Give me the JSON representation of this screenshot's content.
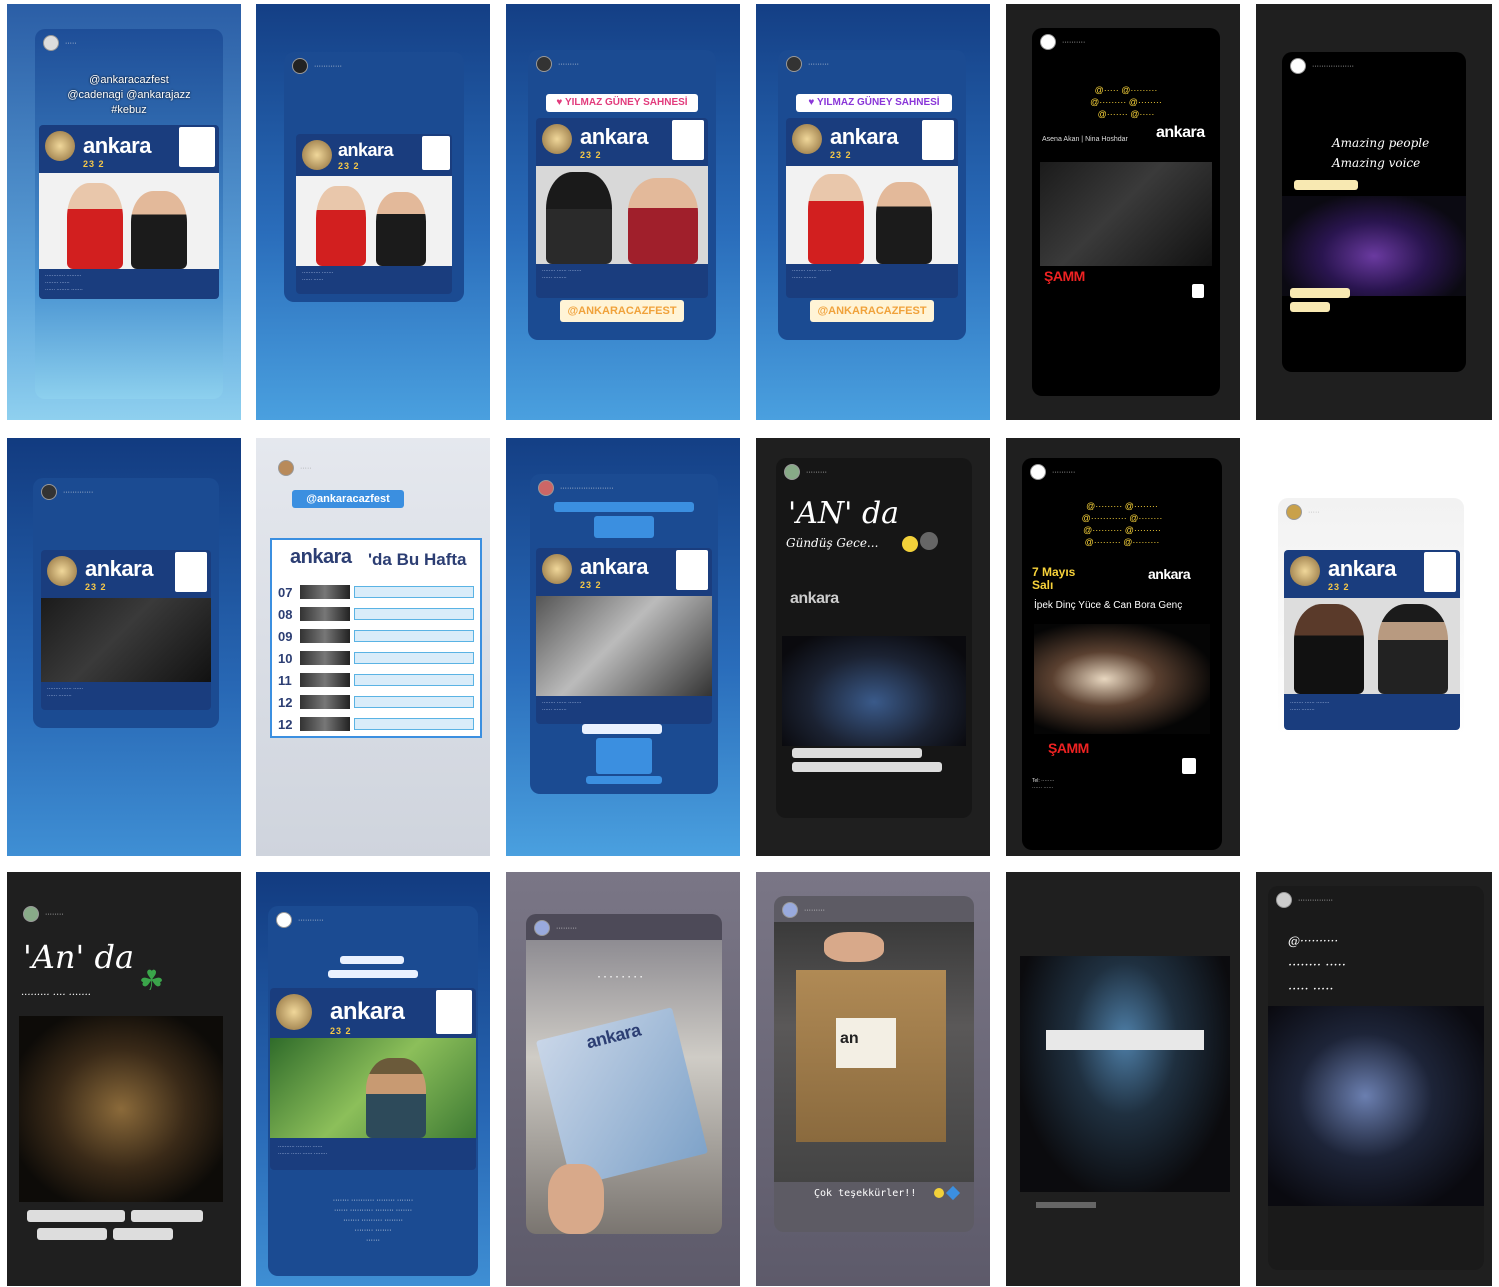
{
  "brand": {
    "name": "ankara",
    "dates": "23 2"
  },
  "stories": [
    {
      "id": "r1c1",
      "hashtags": [
        "@ankaracazfest",
        "@cadenagi @ankarajazz",
        "#kebuz"
      ]
    },
    {
      "id": "r1c3",
      "stickers": {
        "stage": "♥ YILMAZ GÜNEY SAHNESİ",
        "mention": "@ANKARACAZFEST"
      }
    },
    {
      "id": "r1c4",
      "stickers": {
        "stage": "♥ YILMAZ GÜNEY SAHNESİ",
        "mention": "@ANKARACAZFEST"
      }
    },
    {
      "id": "r1c5",
      "names": "Asena Akan | Nina Hoshdar"
    },
    {
      "id": "r1c6",
      "script_lines": [
        "Amazing people",
        "Amazing voice"
      ]
    },
    {
      "id": "r2c2",
      "mention": "@ankaracazfest",
      "heading": "'da Bu Hafta",
      "days": [
        "07",
        "08",
        "09",
        "10",
        "11",
        "12",
        "12"
      ]
    },
    {
      "id": "r2c4",
      "script": "'AN' da",
      "subscript": "Gündüş Gece..."
    },
    {
      "id": "r2c5",
      "date": "7 Mayıs Salı",
      "names": "İpek Dinç Yüce & Can Bora Genç"
    },
    {
      "id": "r3c1",
      "script": "'An' da"
    },
    {
      "id": "r3c4",
      "footer": "Çok teşekkürler!!"
    }
  ]
}
